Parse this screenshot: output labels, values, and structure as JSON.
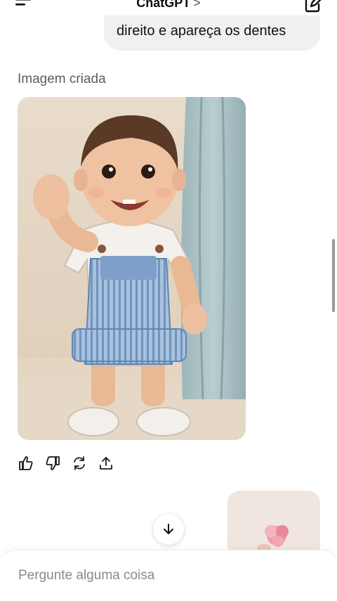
{
  "header": {
    "title": "ChatGPT",
    "title_chevron": ">",
    "menu_icon": "hamburger-menu-icon",
    "edit_icon": "new-chat-edit-icon"
  },
  "conversation": {
    "user_message_tail": "direito e apareça os dentes",
    "assistant": {
      "image_caption": "Imagem criada",
      "image_alt": "Ilustração de um bebê sorrindo e acenando, de macacão listrado azul"
    },
    "actions": [
      {
        "name": "thumbs-up-icon"
      },
      {
        "name": "thumbs-down-icon"
      },
      {
        "name": "regenerate-icon"
      },
      {
        "name": "share-icon"
      }
    ]
  },
  "scroll_button_icon": "arrow-down-icon",
  "composer": {
    "placeholder": "Pergunte alguma coisa"
  },
  "colors": {
    "background": "#ffffff",
    "user_bubble": "#f0f0f2",
    "overall_stripe": "#8fb0d4",
    "curtain": "#a9c0c3"
  }
}
